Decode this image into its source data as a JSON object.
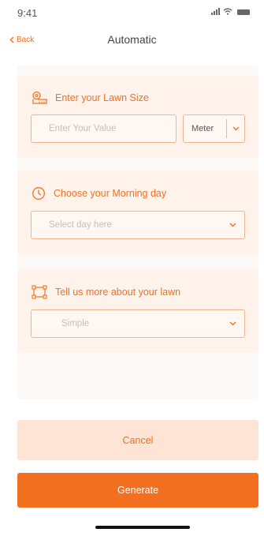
{
  "status_bar": {
    "time": "9:41"
  },
  "nav": {
    "back_label": "Back",
    "title": "Automatic"
  },
  "lawn_size": {
    "label": "Enter your Lawn Size",
    "placeholder": "Enter Your Value",
    "unit": "Meter"
  },
  "morning_day": {
    "label": "Choose your Morning day",
    "placeholder": "Select day here"
  },
  "lawn_details": {
    "label": "Tell us more about your lawn",
    "value": "Simple"
  },
  "actions": {
    "cancel_label": "Cancel",
    "generate_label": "Generate"
  },
  "colors": {
    "accent": "#f37021",
    "card_bg": "#fff3ec",
    "cancel_bg": "#fde4d4"
  },
  "icons": {
    "lawn_size": "tape-measure-icon",
    "morning_day": "clock-icon",
    "lawn_details": "frame-icon",
    "back": "chevron-left-icon",
    "dropdown": "chevron-down-icon"
  }
}
